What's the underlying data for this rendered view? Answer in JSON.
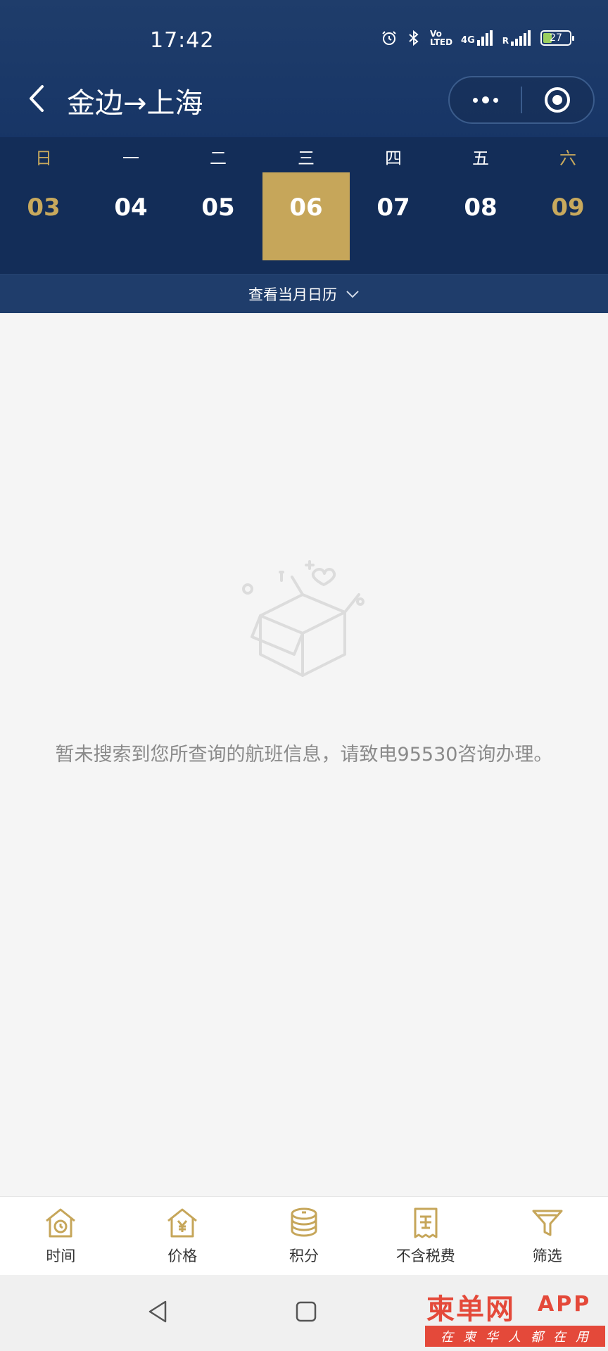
{
  "status_bar": {
    "time": "17:42",
    "network_label": "4G",
    "volte_label": "Vo LTED",
    "roaming_label": "R",
    "battery": "27"
  },
  "title_bar": {
    "title": "金边→上海",
    "back_icon": "chevron-left-icon",
    "more_icon": "more-dots-icon",
    "close_icon": "target-circle-icon"
  },
  "week": {
    "days": [
      {
        "weekday": "日",
        "date": "03",
        "weekend": true
      },
      {
        "weekday": "一",
        "date": "04",
        "weekend": false
      },
      {
        "weekday": "二",
        "date": "05",
        "weekend": false
      },
      {
        "weekday": "三",
        "date": "06",
        "weekend": false,
        "selected": true
      },
      {
        "weekday": "四",
        "date": "07",
        "weekend": false
      },
      {
        "weekday": "五",
        "date": "08",
        "weekend": false
      },
      {
        "weekday": "六",
        "date": "09",
        "weekend": true
      }
    ],
    "selected_color": "#c6a65a",
    "weekend_color": "#c8a95d"
  },
  "calendar_toggle": {
    "label": "查看当月日历"
  },
  "empty_state": {
    "message": "暂未搜索到您所查询的航班信息，请致电95530咨询办理。"
  },
  "tabbar": {
    "items": [
      {
        "label": "时间",
        "icon": "clock-house-icon"
      },
      {
        "label": "价格",
        "icon": "yuan-house-icon"
      },
      {
        "label": "积分",
        "icon": "coin-stack-icon"
      },
      {
        "label": "不含税费",
        "icon": "tax-receipt-icon"
      },
      {
        "label": "筛选",
        "icon": "filter-funnel-icon"
      }
    ],
    "accent_color": "#c6a65a"
  },
  "watermark": {
    "brand": "柬单网",
    "app": "APP",
    "slogan": "在柬华人都在用"
  }
}
